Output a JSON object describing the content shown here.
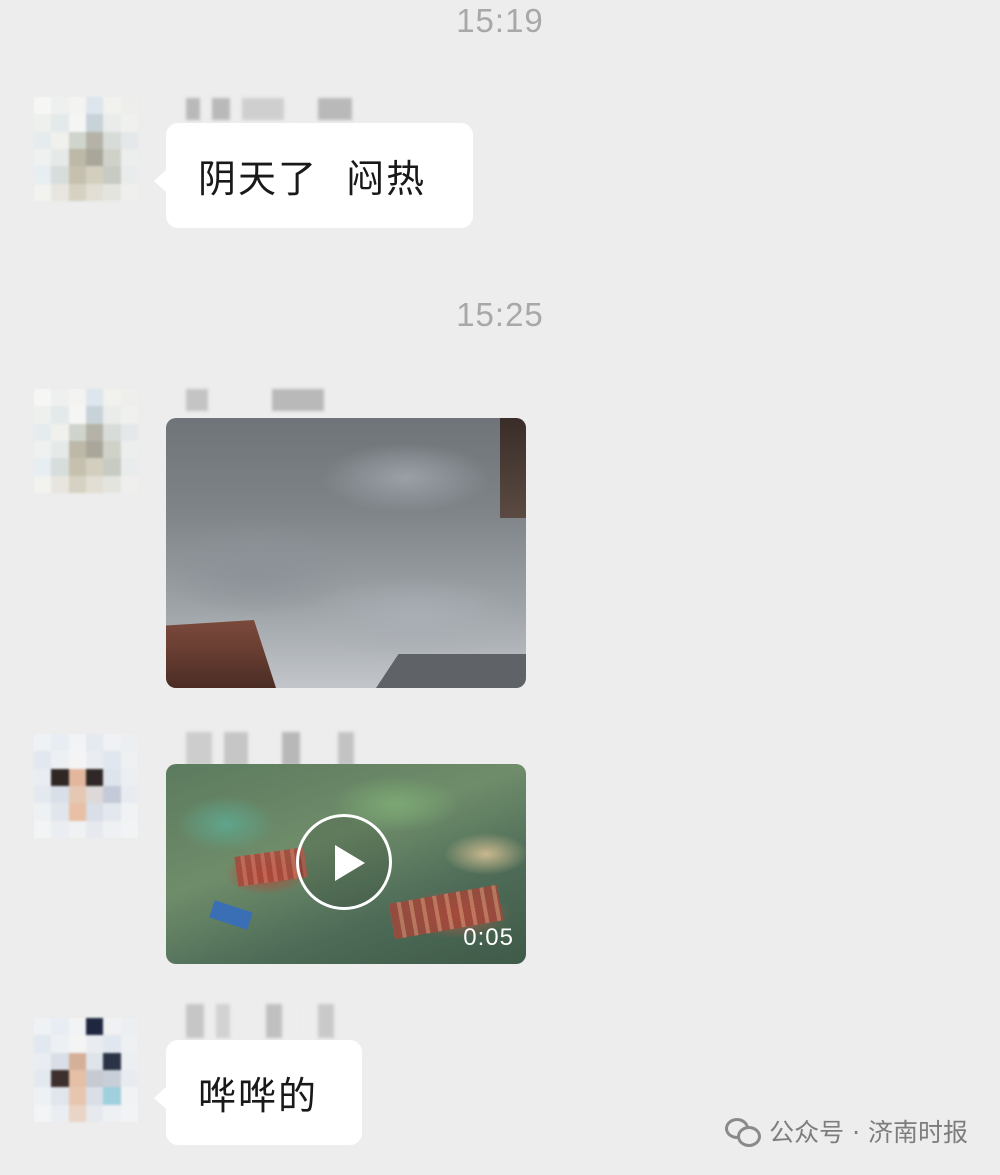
{
  "chat": {
    "messages": [
      {
        "time": "15:19",
        "text": "阴天了  闷热"
      },
      {
        "time": "15:25",
        "image_alt": "overcast-sky"
      },
      {
        "video_duration": "0:05"
      },
      {
        "text": "哗哗的"
      }
    ]
  },
  "watermark": {
    "text": "公众号 · 济南时报",
    "icon": "wechat-icon"
  }
}
